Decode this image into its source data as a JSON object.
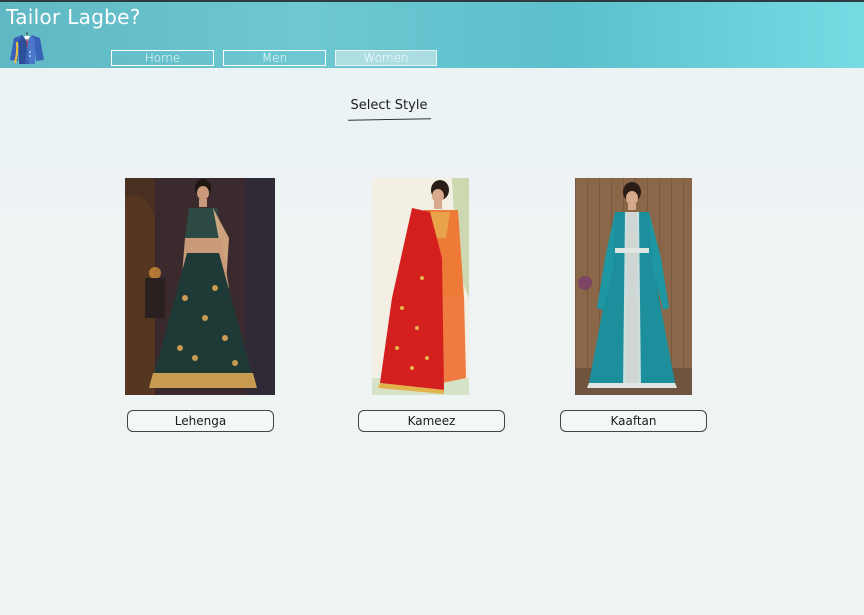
{
  "app": {
    "title": "Tailor Lagbe?"
  },
  "nav": {
    "home": "Home",
    "men": "Men",
    "women": "Women",
    "active": "Women"
  },
  "main": {
    "heading": "Select Style"
  },
  "styles": [
    {
      "label": "Lehenga",
      "image": "lehenga-photo"
    },
    {
      "label": "Kameez",
      "image": "kameez-photo"
    },
    {
      "label": "Kaaftan",
      "image": "kaaftan-photo"
    }
  ],
  "colors": {
    "header_start": "#5fb8c4",
    "header_end": "#76dbe3",
    "background": "#eef3f4"
  }
}
